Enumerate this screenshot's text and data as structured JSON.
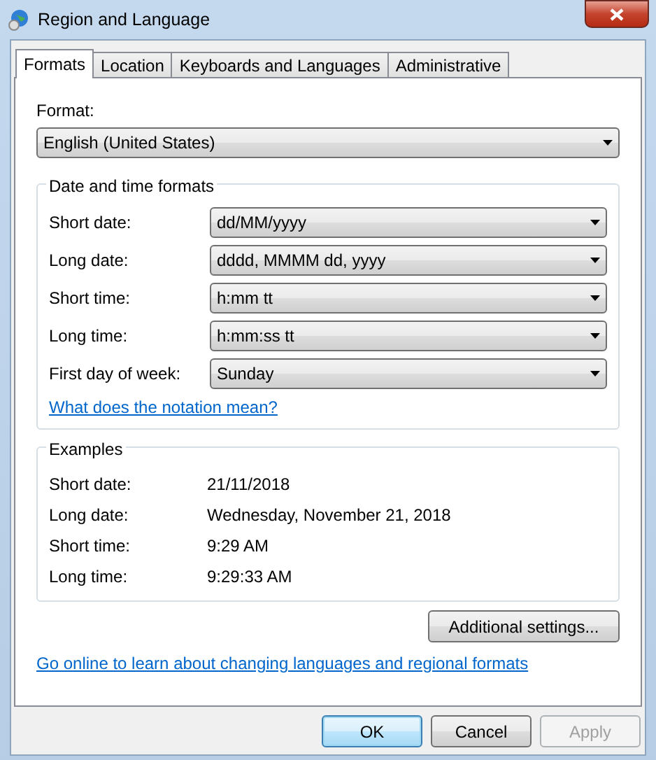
{
  "window": {
    "title": "Region and Language"
  },
  "tabs": [
    {
      "label": "Formats",
      "selected": true
    },
    {
      "label": "Location",
      "selected": false
    },
    {
      "label": "Keyboards and Languages",
      "selected": false
    },
    {
      "label": "Administrative",
      "selected": false
    }
  ],
  "format": {
    "label": "Format:",
    "value": "English (United States)"
  },
  "date_time_formats": {
    "title": "Date and time formats",
    "rows": [
      {
        "label": "Short date:",
        "value": "dd/MM/yyyy"
      },
      {
        "label": "Long date:",
        "value": "dddd, MMMM dd, yyyy"
      },
      {
        "label": "Short time:",
        "value": "h:mm tt"
      },
      {
        "label": "Long time:",
        "value": "h:mm:ss tt"
      },
      {
        "label": "First day of week:",
        "value": "Sunday"
      }
    ],
    "link": "What does the notation mean?"
  },
  "examples": {
    "title": "Examples",
    "rows": [
      {
        "label": "Short date:",
        "value": "21/11/2018"
      },
      {
        "label": "Long date:",
        "value": "Wednesday, November 21, 2018"
      },
      {
        "label": "Short time:",
        "value": "9:29 AM"
      },
      {
        "label": "Long time:",
        "value": "9:29:33 AM"
      }
    ]
  },
  "additional_button": "Additional settings...",
  "online_link": "Go online to learn about changing languages and regional formats",
  "buttons": [
    {
      "label": "OK",
      "default": true,
      "disabled": false
    },
    {
      "label": "Cancel",
      "default": false,
      "disabled": false
    },
    {
      "label": "Apply",
      "default": false,
      "disabled": true
    }
  ]
}
